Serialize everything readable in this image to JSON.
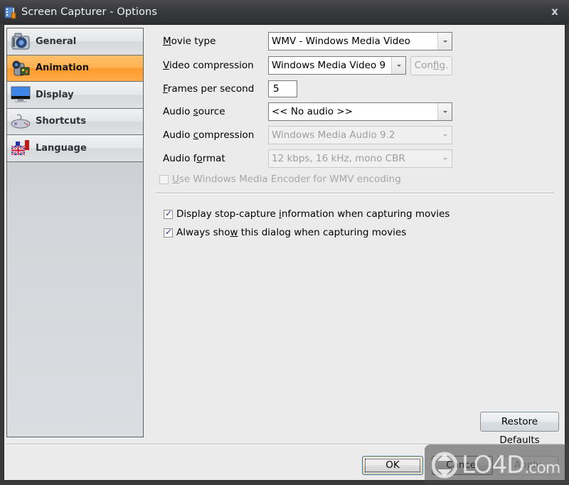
{
  "window": {
    "title": "Screen Capturer - Options",
    "close_label": "x"
  },
  "sidebar": {
    "items": [
      {
        "label": "General",
        "icon": "camera-icon",
        "active": false
      },
      {
        "label": "Animation",
        "icon": "video-camera-icon",
        "active": true
      },
      {
        "label": "Display",
        "icon": "monitor-icon",
        "active": false
      },
      {
        "label": "Shortcuts",
        "icon": "gamepad-icon",
        "active": false
      },
      {
        "label": "Language",
        "icon": "flags-icon",
        "active": false
      }
    ]
  },
  "form": {
    "movie_type": {
      "label_accel": "M",
      "label_rest": "ovie type",
      "value": "WMV - Windows Media Video"
    },
    "video_compression": {
      "label_accel": "V",
      "label_rest": "ideo compression",
      "value": "Windows Media Video 9",
      "config_label_pre": "Con",
      "config_label_accel": "f",
      "config_label_post": "ig."
    },
    "frames_per_second": {
      "label_accel": "F",
      "label_rest": "rames per second",
      "value": "5"
    },
    "audio_source": {
      "label_pre": "Audio ",
      "label_accel": "s",
      "label_post": "ource",
      "value": "<< No audio >>"
    },
    "audio_compression": {
      "label_pre": "Audio ",
      "label_accel": "c",
      "label_post": "ompression",
      "value": "Windows Media Audio 9.2"
    },
    "audio_format": {
      "label_pre": "Audio f",
      "label_accel": "o",
      "label_post": "rmat",
      "value": "12 kbps, 16 kHz, mono CBR"
    },
    "use_wme": {
      "label_accel": "U",
      "label_rest": "se Windows Media Encoder for WMV encoding",
      "checked": false,
      "disabled": true
    },
    "display_stop_info": {
      "label_pre": "Display stop-capture ",
      "label_accel": "i",
      "label_post": "nformation when capturing movies",
      "checked": true
    },
    "always_show": {
      "label_pre": "Always sho",
      "label_accel": "w",
      "label_post": " this dialog when capturing movies",
      "checked": true
    }
  },
  "buttons": {
    "restore_defaults": "Restore Defaults",
    "ok": "OK",
    "cancel": "Cancel",
    "apply": "Apply"
  },
  "watermark": {
    "text": "LO4D",
    "suffix": ".com"
  },
  "colors": {
    "active_tab": "#ff9a2a",
    "titlebar": "#3a3b3f",
    "client_bg": "#ebebeb"
  }
}
